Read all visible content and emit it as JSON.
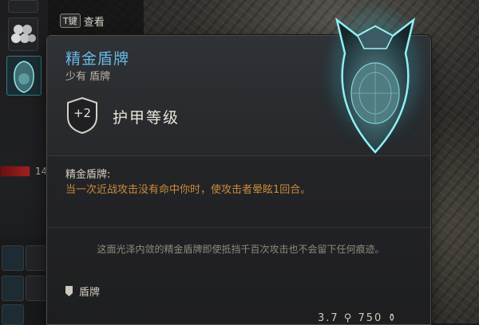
{
  "hud": {
    "key_badge": "T键",
    "key_hint": "查看",
    "side_number": "14"
  },
  "tooltip": {
    "item_name": "精金盾牌",
    "rarity": "少有 盾牌",
    "armor_bonus": "+2",
    "armor_label": "护甲等级",
    "ability_title": "精金盾牌:",
    "ability_desc": "当一次近战攻击没有命中你时，使攻击者晕眩1回合。",
    "flavor_text": "这面光泽内敛的精金盾牌即使抵挡千百次攻击也不会留下任何痕迹。",
    "category": "盾牌",
    "footer_values": "3.7 ⚲ 750 ⚱"
  },
  "colors": {
    "name_blue": "#68b9e6",
    "ability_orange": "#c98a3a",
    "art_glow": "#6fe3f0"
  }
}
